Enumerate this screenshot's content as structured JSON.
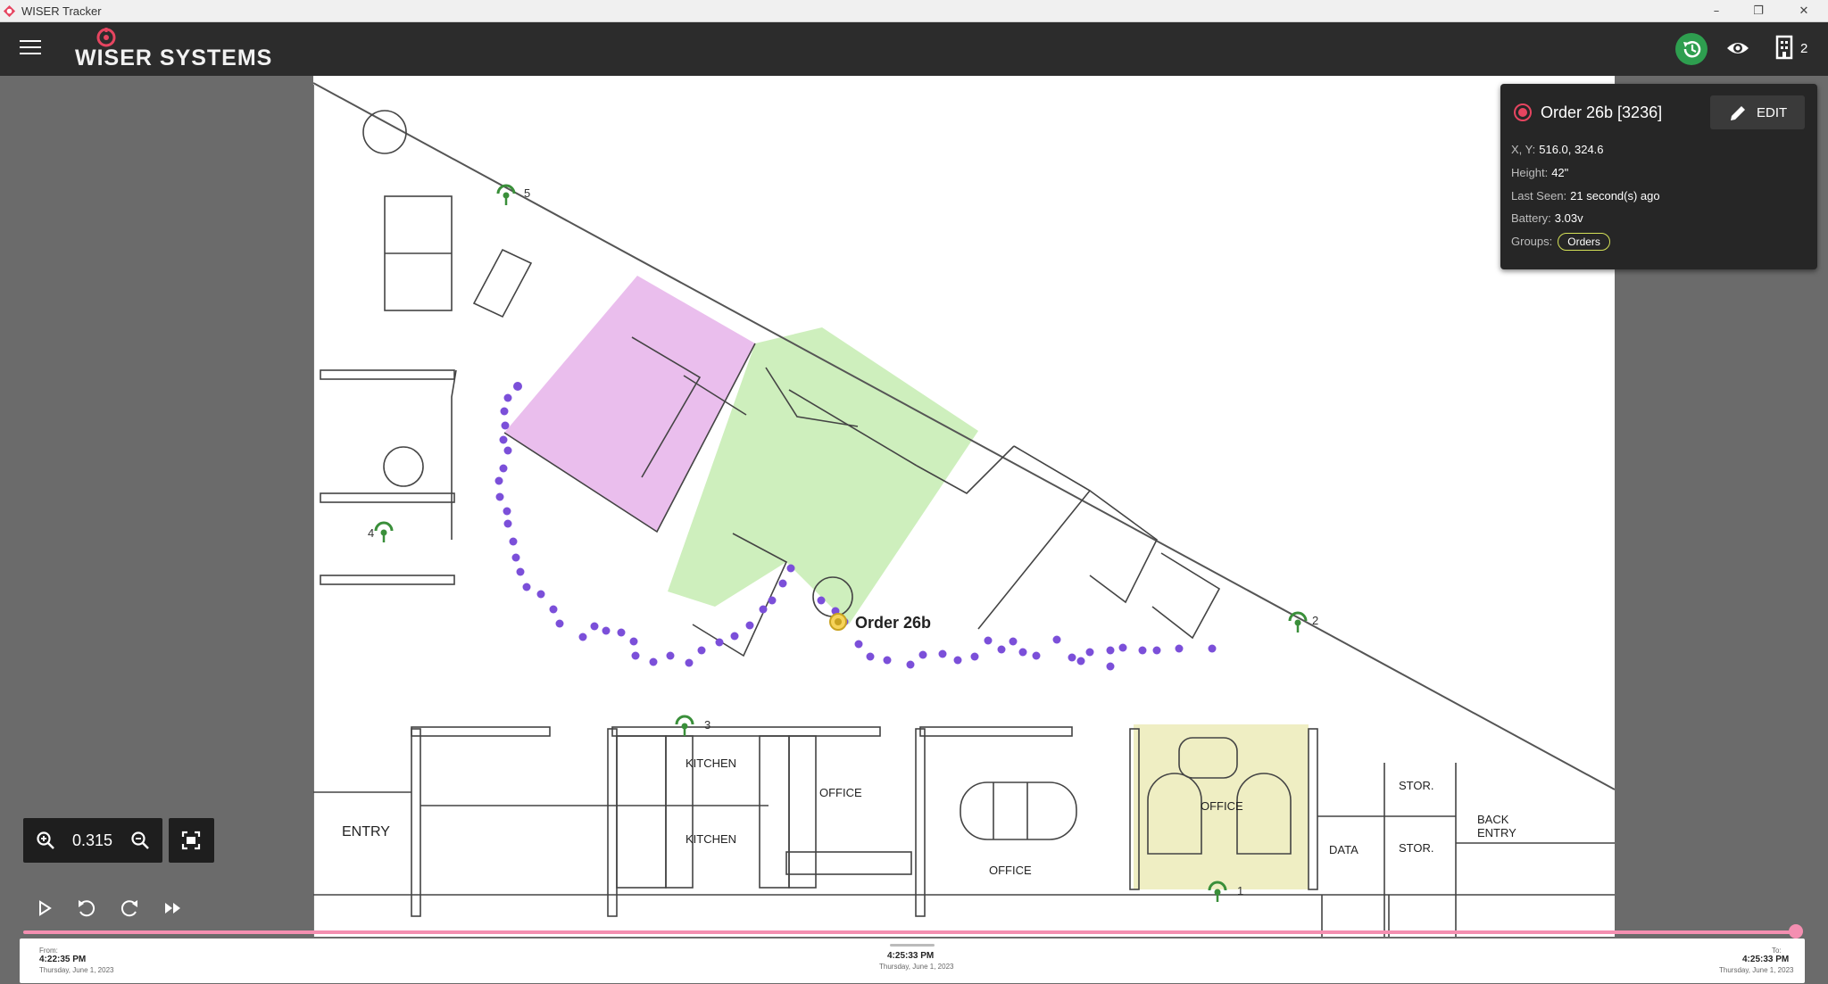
{
  "window": {
    "title": "WISER Tracker",
    "minimize": "–",
    "restore": "❐",
    "close": "✕"
  },
  "appbar": {
    "brand": "WISER SYSTEMS",
    "building_count": "2",
    "accent": "#2e9e4f"
  },
  "info_card": {
    "name": "Order 26b [3236]",
    "edit_label": "EDIT",
    "fields": [
      {
        "key": "X, Y:",
        "value": "516.0, 324.6"
      },
      {
        "key": "Height:",
        "value": "42\""
      },
      {
        "key": "Last Seen:",
        "value": "21 second(s) ago"
      },
      {
        "key": "Battery:",
        "value": "3.03v"
      }
    ],
    "groups_key": "Groups:",
    "group": "Orders",
    "record_color": "#e64560",
    "group_color": "#d4e157"
  },
  "map": {
    "tag_label": "Order 26b",
    "anchors": [
      "5",
      "4",
      "3",
      "2",
      "1"
    ],
    "rooms": {
      "kitchen_1": "KITCHEN",
      "kitchen_2": "KITCHEN",
      "office_a": "OFFICE",
      "office_b": "OFFICE",
      "office_c": "OFFICE",
      "entry": "ENTRY",
      "data": "DATA",
      "stor_1": "STOR.",
      "stor_2": "STOR.",
      "back_entry_1": "BACK",
      "back_entry_2": "ENTRY"
    },
    "zones": {
      "pink": "#e6b3ea",
      "green": "#c5ecb2",
      "yellow": "#efeec3"
    },
    "trail_color": "#7b4fd9"
  },
  "zoom": {
    "value": "0.315"
  },
  "timeline": {
    "from_label": "From:",
    "from_time": "4:22:35 PM",
    "from_date": "Thursday, June 1, 2023",
    "current_time": "4:25:33 PM",
    "current_date": "Thursday, June 1, 2023",
    "to_label": "To:",
    "to_time": "4:25:33 PM",
    "to_date": "Thursday, June 1, 2023",
    "track_color": "#f48fb1"
  }
}
